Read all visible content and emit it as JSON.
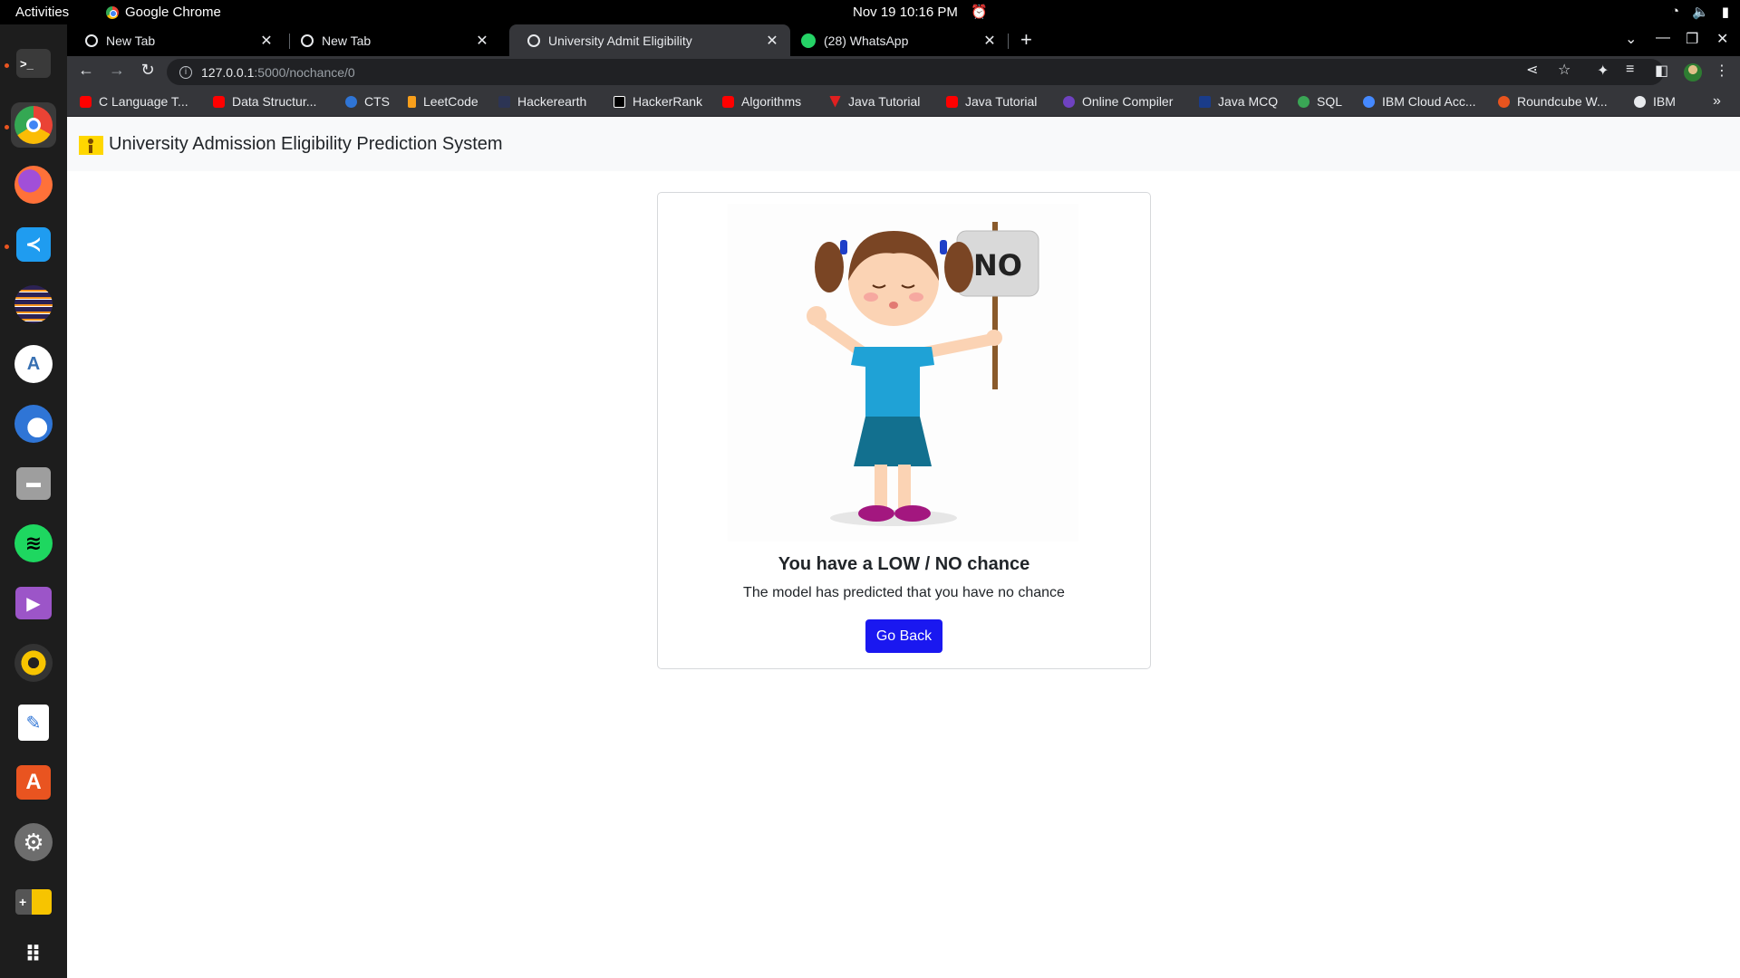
{
  "system": {
    "activities": "Activities",
    "app_name": "Google Chrome",
    "clock": "Nov 19  10:16 PM"
  },
  "browser": {
    "tabs": [
      {
        "title": "New Tab"
      },
      {
        "title": "New Tab"
      },
      {
        "title": "University Admit Eligibility"
      },
      {
        "title": "(28) WhatsApp"
      }
    ],
    "url_host": "127.0.0.1",
    "url_path": ":5000/nochance/0",
    "bookmarks": [
      {
        "label": "C Language T..."
      },
      {
        "label": "Data Structur..."
      },
      {
        "label": "CTS"
      },
      {
        "label": "LeetCode"
      },
      {
        "label": "Hackerearth"
      },
      {
        "label": "HackerRank"
      },
      {
        "label": "Algorithms"
      },
      {
        "label": "Java Tutorial"
      },
      {
        "label": "Java Tutorial"
      },
      {
        "label": "Online Compiler"
      },
      {
        "label": "Java MCQ"
      },
      {
        "label": "SQL"
      },
      {
        "label": "IBM Cloud Acc..."
      },
      {
        "label": "Roundcube W..."
      },
      {
        "label": "IBM"
      }
    ]
  },
  "navbar": {
    "brand": "University Admission Eligibility Prediction System"
  },
  "result": {
    "sign_text": "NO",
    "title": "You have a LOW / NO chance",
    "message": "The model has predicted that you have no chance",
    "button_label": "Go Back"
  },
  "colors": {
    "accent_button": "#1a18f0",
    "navbar_bg": "#f8f9fa"
  }
}
